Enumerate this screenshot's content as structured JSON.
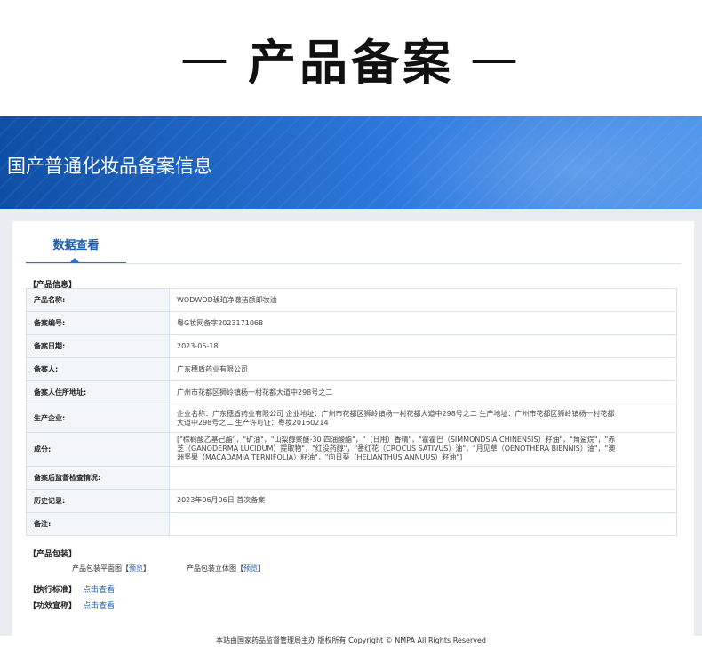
{
  "hero": {
    "dash_left": "—",
    "title": "产品备案",
    "dash_right": "—"
  },
  "banner": {
    "title": "国产普通化妆品备案信息"
  },
  "tabs": [
    {
      "label": "数据查看"
    }
  ],
  "product_info": {
    "section_label": "【产品信息】",
    "rows": [
      {
        "key": "产品名称:",
        "value": "WODWOD琥珀净澈洁颜卸妆油"
      },
      {
        "key": "备案编号:",
        "value": "粤G妆网备字2023171068"
      },
      {
        "key": "备案日期:",
        "value": "2023-05-18"
      },
      {
        "key": "备案人:",
        "value": "广东穗盾药业有限公司"
      },
      {
        "key": "备案人住所地址:",
        "value": "广州市花都区狮岭镇杨一村花都大道中298号之二"
      },
      {
        "key": "生产企业:",
        "value_line1": "企业名称：广东穗盾药业有限公司 企业地址：广州市花都区狮岭镇杨一村花都大道中298号之二 生产地址：广州市花都区狮岭镇杨一村花都",
        "value_line2": "大道中298号之二 生产许可证：粤妆20160214"
      },
      {
        "key": "成分:",
        "value_line1": "[\"棕榈酸乙基己酯\"，\"矿油\"，\"山梨醇聚醚-30 四油酸酯\"，\"（日用）香精\"，\"霍霍巴（SIMMONDSIA CHINENSIS）籽油\"，\"角鲨烷\"，\"赤",
        "value_line2": "芝（GANODERMA LUCIDUM）提取物\"，\"红没药醇\"，\"番红花（CROCUS SATIVUS）油\"，\"月见草（OENOTHERA BIENNIS）油\"，\"澳",
        "value_line3": "洲坚果（MACADAMIA TERNIFOLIA）籽油\"，\"向日葵（HELIANTHUS ANNUUS）籽油\"]"
      },
      {
        "key": "备案后监督检查情况:",
        "value": ""
      },
      {
        "key": "历史记录:",
        "value": "2023年06月06日 首次备案"
      },
      {
        "key": "备注:",
        "value": ""
      }
    ]
  },
  "packaging": {
    "section_label": "【产品包装】",
    "flat_label": "产品包装平面图",
    "solid_label": "产品包装立体图",
    "bracket_open": "【",
    "bracket_close": "】",
    "preview_link": "预览"
  },
  "standard": {
    "label": "【执行标准】",
    "link": "点击查看"
  },
  "claims": {
    "label": "【功效宣称】",
    "link": "点击查看"
  },
  "footer": {
    "text": "本站由国家药品监督管理局主办 版权所有 Copyright © NMPA All Rights Reserved"
  }
}
